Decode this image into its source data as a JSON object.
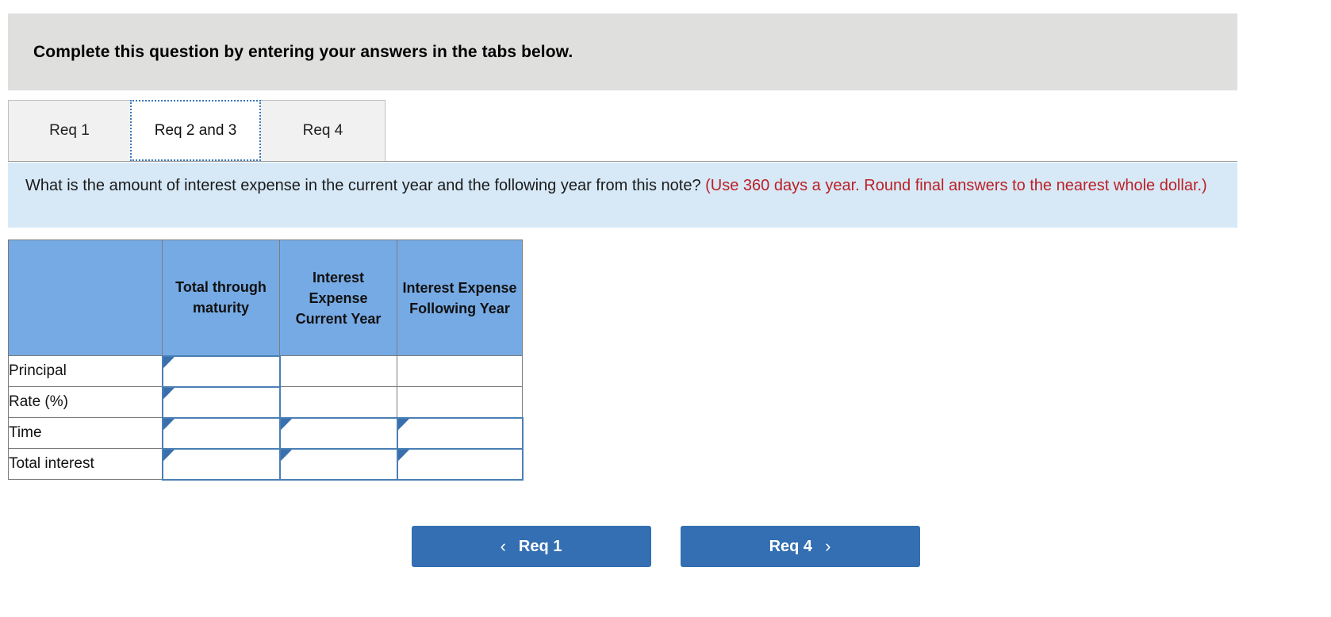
{
  "header": {
    "instruction": "Complete this question by entering your answers in the tabs below."
  },
  "tabs": [
    {
      "label": "Req 1",
      "active": false
    },
    {
      "label": "Req 2 and 3",
      "active": true
    },
    {
      "label": "Req 4",
      "active": false
    }
  ],
  "question": {
    "text": "What is the amount of interest expense in the current year and the following year from this note?",
    "hint": "(Use 360 days a year. Round final answers to the nearest whole dollar.)"
  },
  "table": {
    "columns": [
      "",
      "Total through maturity",
      "Interest Expense Current Year",
      "Interest Expense Following Year"
    ],
    "rows": [
      {
        "label": "Principal",
        "cells": [
          {
            "value": "",
            "input": true
          },
          {
            "value": "",
            "input": false
          },
          {
            "value": "",
            "input": false
          }
        ]
      },
      {
        "label": "Rate (%)",
        "cells": [
          {
            "value": "",
            "input": true
          },
          {
            "value": "",
            "input": false
          },
          {
            "value": "",
            "input": false
          }
        ]
      },
      {
        "label": "Time",
        "cells": [
          {
            "value": "",
            "input": true
          },
          {
            "value": "",
            "input": true
          },
          {
            "value": "",
            "input": true
          }
        ]
      },
      {
        "label": "Total interest",
        "cells": [
          {
            "value": "",
            "input": true
          },
          {
            "value": "",
            "input": true
          },
          {
            "value": "",
            "input": true
          }
        ]
      }
    ]
  },
  "nav": {
    "prev_label": "Req 1",
    "prev_icon": "chevron-left-icon",
    "next_label": "Req 4",
    "next_icon": "chevron-right-icon",
    "prev_chevron": "‹",
    "next_chevron": "›"
  },
  "colors": {
    "header_bar": "#dfdfde",
    "banner": "#d7e9f7",
    "table_header": "#76aae4",
    "hint_red": "#bb2025",
    "button_blue": "#336fb2",
    "input_border": "#4a7fb5"
  }
}
